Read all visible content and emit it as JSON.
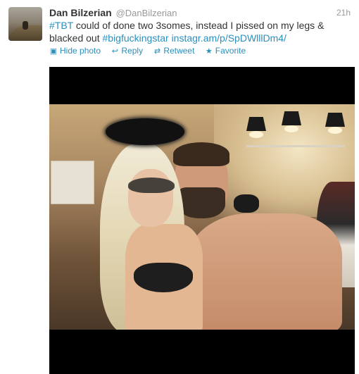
{
  "tweet": {
    "author_name": "Dan Bilzerian",
    "author_handle": "@DanBilzerian",
    "timestamp": "21h",
    "text_parts": {
      "hashtag_tbt": "#TBT",
      "body": " could of done two 3somes, instead I pissed on my legs & blacked out ",
      "hashtag_star": "#bigfuckingstar",
      "link": "instagr.am/p/SpDWlllDm4/"
    }
  },
  "actions": [
    {
      "label": "Hide photo",
      "icon": "photo-icon"
    },
    {
      "label": "Reply",
      "icon": "reply-icon"
    },
    {
      "label": "Retweet",
      "icon": "retweet-icon"
    },
    {
      "label": "Favorite",
      "icon": "star-icon"
    }
  ],
  "colors": {
    "link": "#2a8fbd",
    "name": "#333333",
    "muted": "#999999"
  }
}
